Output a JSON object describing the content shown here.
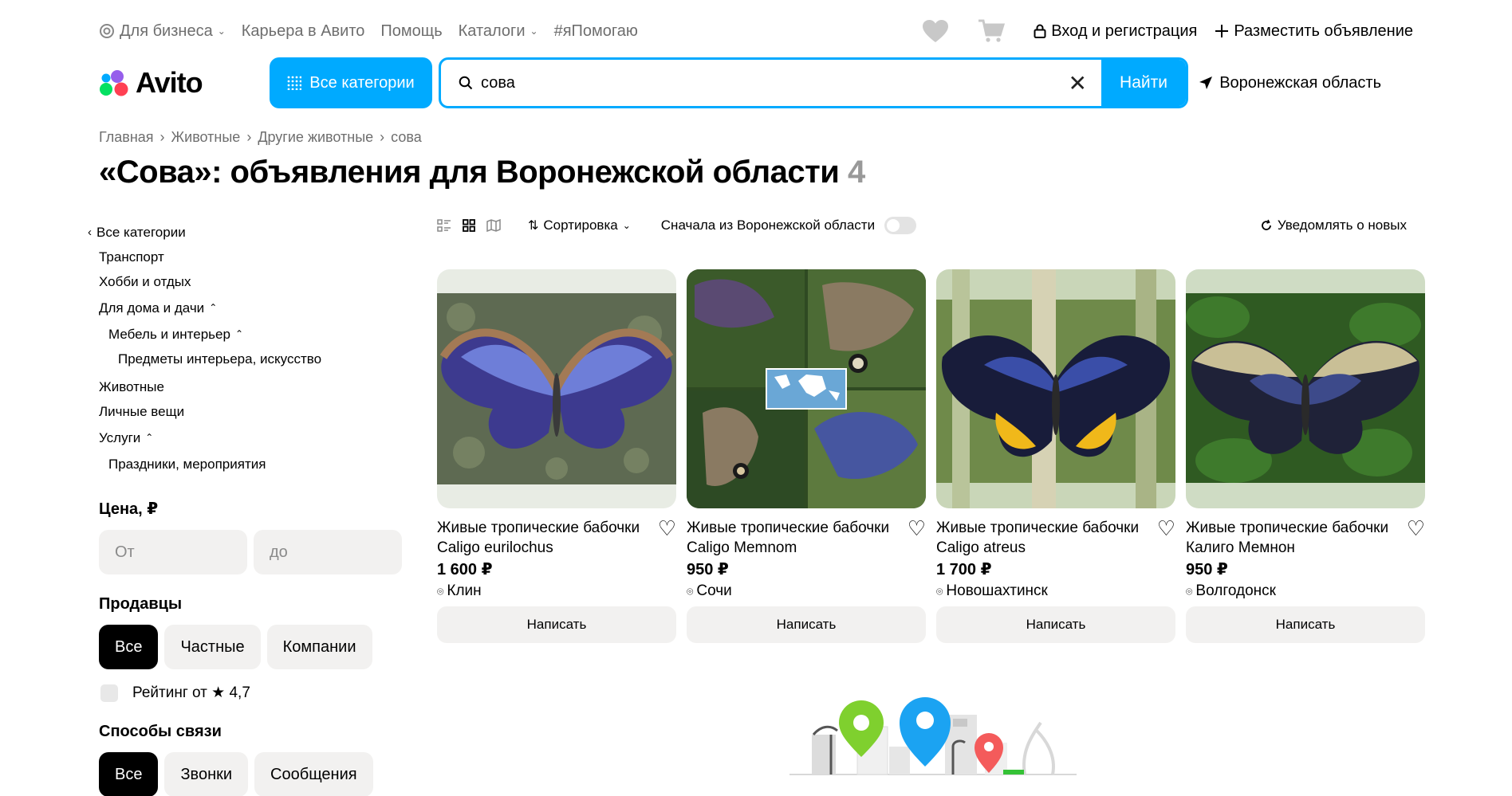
{
  "topbar": {
    "links": [
      {
        "label": "Для бизнеса",
        "has_dropdown": true,
        "icon": "business-icon"
      },
      {
        "label": "Карьера в Авито",
        "has_dropdown": false
      },
      {
        "label": "Помощь",
        "has_dropdown": false
      },
      {
        "label": "Каталоги",
        "has_dropdown": true
      },
      {
        "label": "#яПомогаю",
        "has_dropdown": false
      }
    ],
    "login_label": "Вход и регистрация",
    "post_ad_label": "Разместить объявление"
  },
  "header": {
    "logo_text": "Avito",
    "all_categories_label": "Все категории",
    "search": {
      "value": "сова",
      "placeholder": ""
    },
    "find_label": "Найти",
    "region": "Воронежская область"
  },
  "breadcrumbs": [
    "Главная",
    "Животные",
    "Другие животные",
    "сова"
  ],
  "page_title": {
    "text": "«Сова»: объявления для Воронежской области",
    "count": "4"
  },
  "sidebar": {
    "categories": [
      {
        "label": "Все категории",
        "level": "back"
      },
      {
        "label": "Транспорт",
        "level": "l0"
      },
      {
        "label": "Хобби и отдых",
        "level": "l0"
      },
      {
        "label": "Для дома и дачи",
        "level": "l0",
        "expanded": true
      },
      {
        "label": "Мебель и интерьер",
        "level": "l1",
        "expanded": true
      },
      {
        "label": "Предметы интерьера, искусство",
        "level": "l2"
      },
      {
        "label": "Животные",
        "level": "l0"
      },
      {
        "label": "Личные вещи",
        "level": "l0"
      },
      {
        "label": "Услуги",
        "level": "l0",
        "expanded": true
      },
      {
        "label": "Праздники, мероприятия",
        "level": "l1"
      }
    ],
    "price": {
      "heading": "Цена, ₽",
      "from_placeholder": "От",
      "to_placeholder": "до"
    },
    "sellers": {
      "heading": "Продавцы",
      "options": [
        "Все",
        "Частные",
        "Компании"
      ],
      "selected": "Все"
    },
    "rating": {
      "label": "Рейтинг от ★ 4,7",
      "checked": false
    },
    "contact": {
      "heading": "Способы связи",
      "options": [
        "Все",
        "Звонки",
        "Сообщения"
      ],
      "selected": "Все"
    }
  },
  "toolbar": {
    "sort_label": "Сортировка",
    "local_first_label": "Сначала из Воронежской области",
    "local_first_on": false,
    "notify_label": "Уведомлять о новых"
  },
  "listings": [
    {
      "title": "Живые тропические бабочки Caligo eurilochus",
      "price": "1 600 ₽",
      "location": "Клин",
      "button": "Написать",
      "image": "butterfly-blue-on-moss"
    },
    {
      "title": "Живые тропические бабочки Caligo Memnom",
      "price": "950 ₽",
      "location": "Сочи",
      "button": "Написать",
      "image": "butterfly-collage-map"
    },
    {
      "title": "Живые тропические бабочки Caligo atreus",
      "price": "1 700 ₽",
      "location": "Новошахтинск",
      "button": "Написать",
      "image": "butterfly-yellow-band"
    },
    {
      "title": "Живые тропические бабочки Калиго Мемнон",
      "price": "950 ₽",
      "location": "Волгодонск",
      "button": "Написать",
      "image": "butterfly-cream-wings"
    }
  ],
  "colors": {
    "accent": "#00aaff",
    "chip_bg": "#f2f1f0",
    "active_chip": "#000000",
    "muted_text": "#6e6e6e"
  }
}
